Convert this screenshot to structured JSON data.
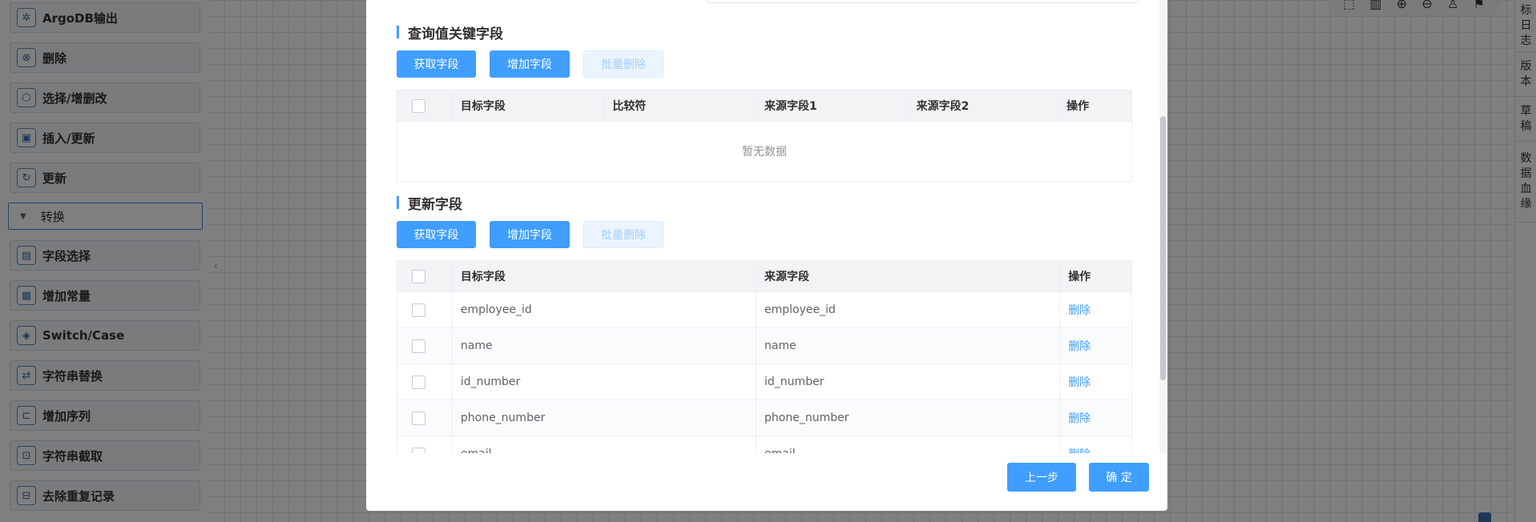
{
  "sidebar": {
    "items": [
      {
        "label": "ArgoDB输出",
        "icon": "✲"
      },
      {
        "label": "删除",
        "icon": "⊗"
      },
      {
        "label": "选择/增删改",
        "icon": "⬡"
      },
      {
        "label": "插入/更新",
        "icon": "▣"
      },
      {
        "label": "更新",
        "icon": "↻"
      }
    ],
    "group_label": "转换",
    "group_items": [
      {
        "label": "字段选择",
        "icon": "▤"
      },
      {
        "label": "增加常量",
        "icon": "▦"
      },
      {
        "label": "Switch/Case",
        "icon": "◈"
      },
      {
        "label": "字符串替换",
        "icon": "⇄"
      },
      {
        "label": "增加序列",
        "icon": "⊏"
      },
      {
        "label": "字符串截取",
        "icon": "⊡"
      },
      {
        "label": "去除重复记录",
        "icon": "⊟"
      }
    ],
    "collapse_icon": "‹"
  },
  "right_rail": {
    "tabs": [
      {
        "chars": [
          "标",
          "日",
          "志"
        ]
      },
      {
        "chars": [
          "版",
          "本"
        ]
      },
      {
        "chars": [
          "草",
          "稿"
        ]
      },
      {
        "chars": [
          "数",
          "据",
          "血",
          "缘"
        ]
      }
    ]
  },
  "toolbar_icons": [
    "⬚",
    "▥",
    "⊕",
    "⊖",
    "♙",
    "⚑"
  ],
  "dialog": {
    "query_section": {
      "title": "查询值关键字段",
      "buttons": {
        "fetch": "获取字段",
        "add": "增加字段",
        "batch_delete": "批量删除"
      },
      "columns": [
        "目标字段",
        "比较符",
        "来源字段1",
        "来源字段2",
        "操作"
      ],
      "empty_text": "暂无数据"
    },
    "update_section": {
      "title": "更新字段",
      "buttons": {
        "fetch": "获取字段",
        "add": "增加字段",
        "batch_delete": "批量删除"
      },
      "columns": [
        "目标字段",
        "来源字段",
        "操作"
      ],
      "rows": [
        {
          "target": "employee_id",
          "source": "employee_id",
          "action": "删除"
        },
        {
          "target": "name",
          "source": "name",
          "action": "删除"
        },
        {
          "target": "id_number",
          "source": "id_number",
          "action": "删除"
        },
        {
          "target": "phone_number",
          "source": "phone_number",
          "action": "删除"
        },
        {
          "target": "email",
          "source": "email",
          "action": "删除"
        }
      ]
    },
    "footer": {
      "prev": "上一步",
      "confirm": "确 定"
    }
  }
}
